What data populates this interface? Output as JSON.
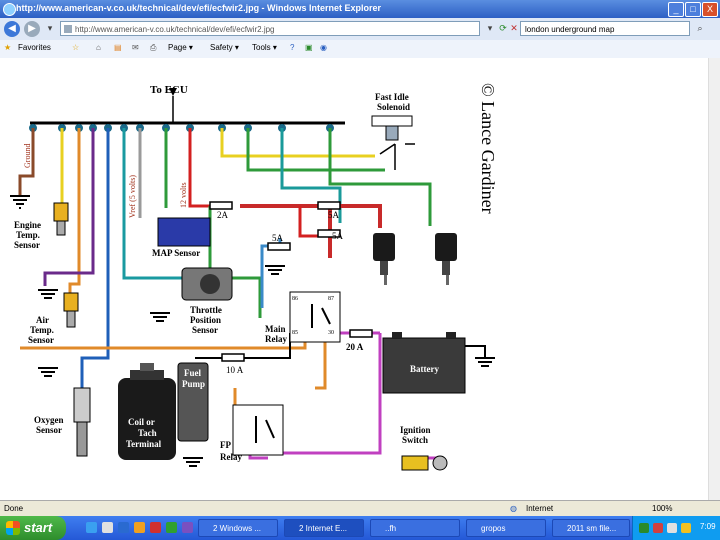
{
  "window": {
    "title": "http://www.american-v.co.uk/technical/dev/efi/ecfwir2.jpg - Windows Internet Explorer",
    "min": "_",
    "max": "□",
    "close": "X"
  },
  "address_bar": {
    "url": "http://www.american-v.co.uk/technical/dev/efi/ecfwir2.jpg",
    "search_value": "london underground map"
  },
  "command_bar": {
    "favorites": "Favorites",
    "page": "Page ▾",
    "safety": "Safety ▾",
    "tools": "Tools ▾"
  },
  "diagram": {
    "ecu_label": "To ECU",
    "ground_label": "Ground",
    "vref_label": "Vref (5 volts)",
    "twelve_volts_label": "12 volts",
    "copyright": "© Lance Gardiner",
    "fast_idle": [
      "Fast Idle",
      "Solenoid"
    ],
    "engine_temp": [
      "Engine",
      "Temp.",
      "Sensor"
    ],
    "air_temp": [
      "Air",
      "Temp.",
      "Sensor"
    ],
    "oxygen": [
      "Oxygen",
      "Sensor"
    ],
    "map_sensor": "MAP Sensor",
    "throttle": [
      "Throttle",
      "Position",
      "Sensor"
    ],
    "main_relay": [
      "Main",
      "Relay"
    ],
    "fp_relay": [
      "FP",
      "Relay"
    ],
    "fuel_pump": [
      "Fuel",
      "Pump"
    ],
    "coil": [
      "Coil or",
      "Tach",
      "Terminal"
    ],
    "battery": "Battery",
    "ignition": [
      "Ignition",
      "Switch"
    ],
    "fuse_2a": "2A",
    "fuse_5a_top": "5A",
    "fuse_5a_mid": "5A",
    "fuse_5a_left": "5A",
    "fuse_10a": "10 A",
    "fuse_20a": "20 A",
    "relay_pins": [
      "86",
      "87",
      "85",
      "30"
    ]
  },
  "status_bar": {
    "done": "Done",
    "zone": "Internet",
    "zoom": "100%"
  },
  "taskbar": {
    "start": "start",
    "tasks": [
      "2 Windows ...",
      "2 Internet E...",
      "..fh",
      "gropos",
      "2011 sm file..."
    ],
    "clock": "7:09"
  },
  "colors": {
    "green": "#2e9a3a",
    "yellow": "#e8d020",
    "red": "#d32020",
    "orange": "#e08a2a",
    "blue": "#1f5fb8",
    "darkblue": "#1a2d8a",
    "purple": "#7a2a8a",
    "teal": "#1a9a9a",
    "gray": "#9a9a9a",
    "pink": "#c040c0"
  }
}
